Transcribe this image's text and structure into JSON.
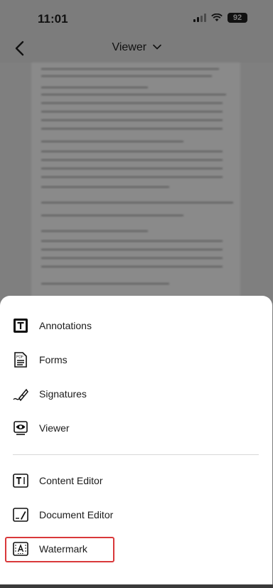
{
  "status_bar": {
    "time": "11:01",
    "battery": "92"
  },
  "nav": {
    "title": "Viewer"
  },
  "menu": {
    "items": [
      {
        "label": "Annotations",
        "icon": "annotations-icon"
      },
      {
        "label": "Forms",
        "icon": "pdf-forms-icon"
      },
      {
        "label": "Signatures",
        "icon": "signature-pen-icon"
      },
      {
        "label": "Viewer",
        "icon": "eye-viewer-icon"
      },
      {
        "label": "Content Editor",
        "icon": "text-editor-icon"
      },
      {
        "label": "Document Editor",
        "icon": "document-editor-icon"
      },
      {
        "label": "Watermark",
        "icon": "watermark-icon"
      }
    ],
    "highlighted": "Watermark"
  },
  "colors": {
    "highlight": "#d9383a"
  }
}
